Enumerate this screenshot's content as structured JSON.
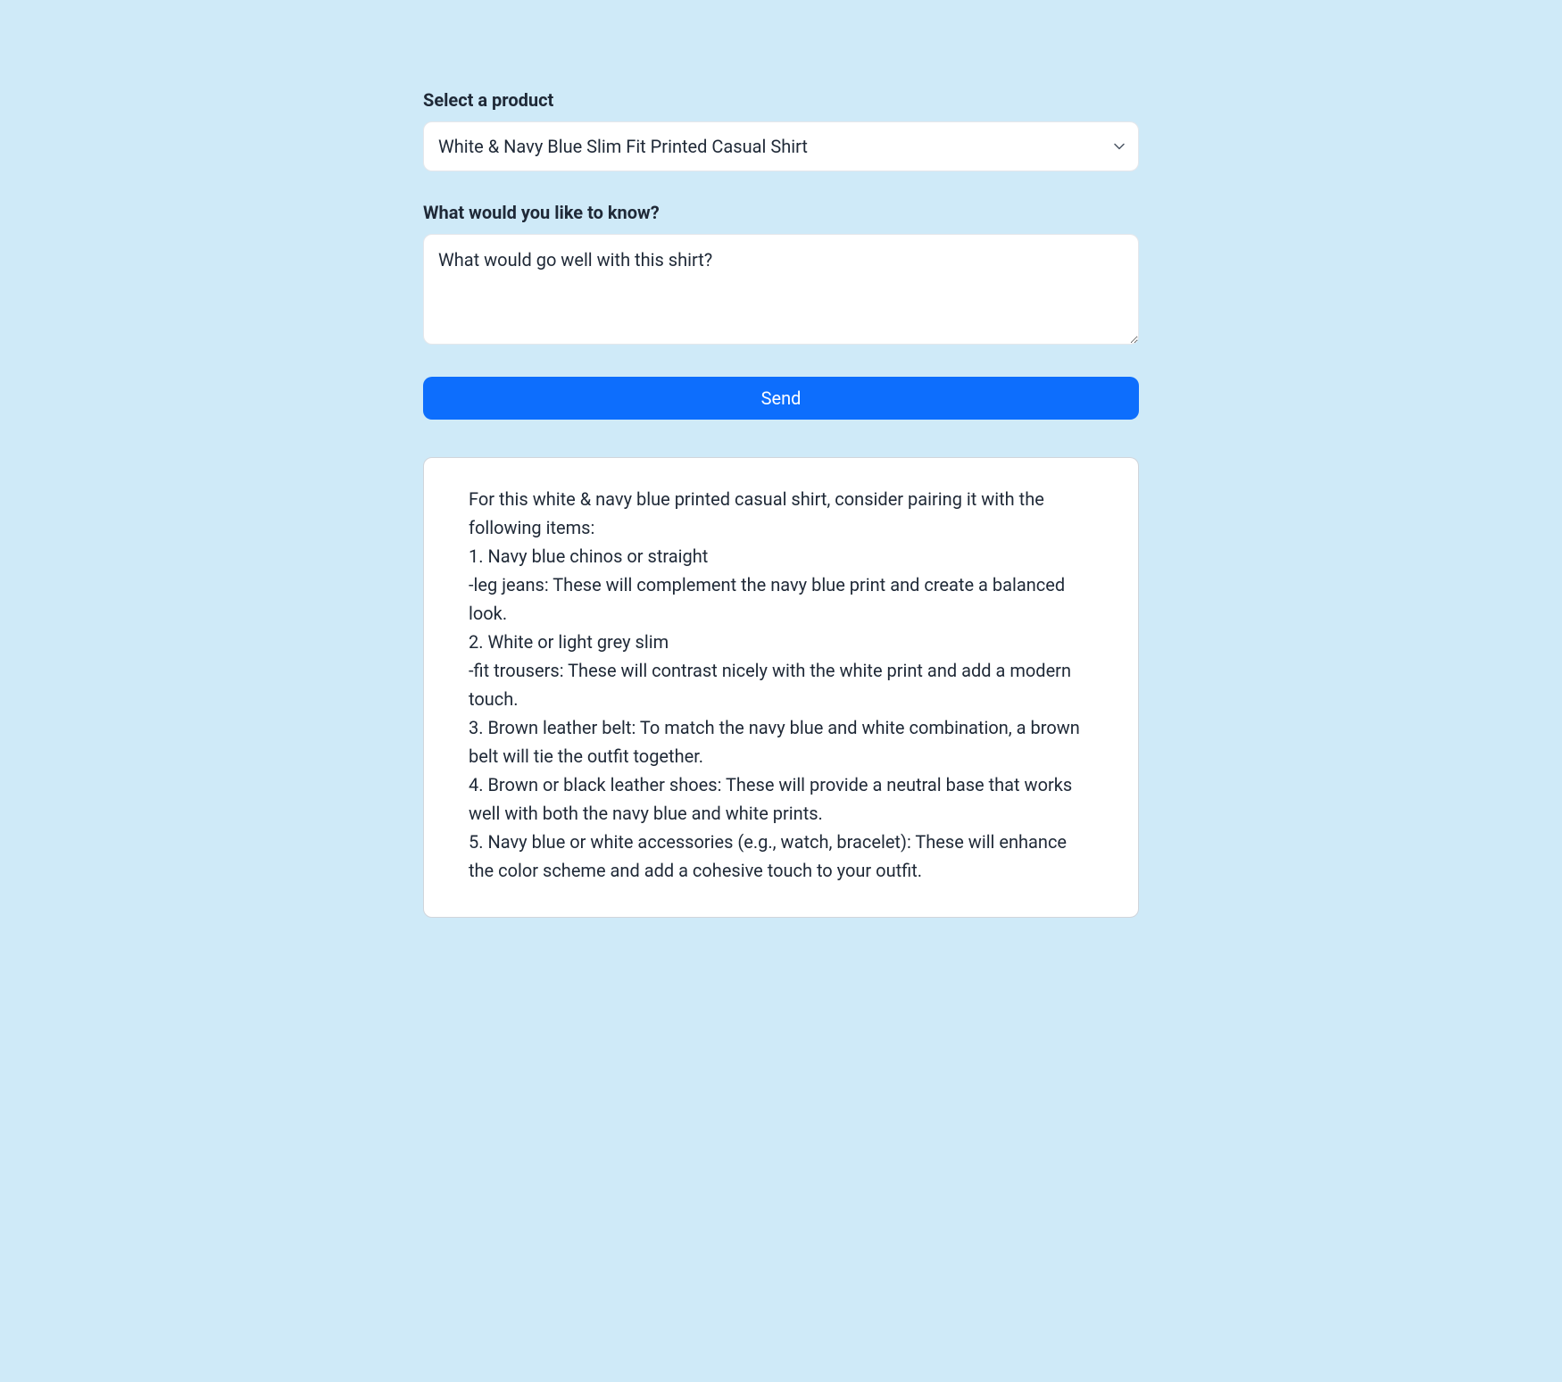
{
  "form": {
    "product_label": "Select a product",
    "product_selected": "White & Navy Blue Slim Fit Printed Casual Shirt",
    "question_label": "What would you like to know?",
    "question_value": "What would go well with this shirt?",
    "send_label": "Send"
  },
  "response": {
    "text": "For this white & navy blue printed casual shirt, consider pairing it with the following items:\n1. Navy blue chinos or straight\n-leg jeans: These will complement the navy blue print and create a balanced look.\n2. White or light grey slim\n-fit trousers: These will contrast nicely with the white print and add a modern touch.\n3. Brown leather belt: To match the navy blue and white combination, a brown belt will tie the outfit together.\n4. Brown or black leather shoes: These will provide a neutral base that works well with both the navy blue and white prints.\n5. Navy blue or white accessories (e.g., watch, bracelet): These will enhance the color scheme and add a cohesive touch to your outfit."
  }
}
